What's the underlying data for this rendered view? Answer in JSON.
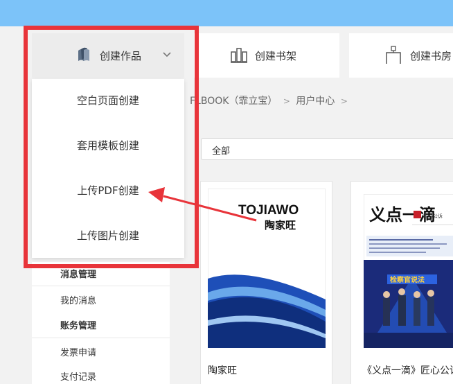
{
  "toolbar": {
    "create_label": "创建作品",
    "shelf_label": "创建书架",
    "room_label": "创建书房"
  },
  "dropdown": {
    "items": [
      "空白页面创建",
      "套用模板创建",
      "上传PDF创建",
      "上传图片创建"
    ]
  },
  "breadcrumb": {
    "part1": "FLBOOK（霏立宝）",
    "sep": ">",
    "part2": "用户中心",
    "sep2": ">"
  },
  "filter": {
    "value": "全部"
  },
  "sidebar": {
    "section_messages": "消息管理",
    "my_messages": "我的消息",
    "section_accounts": "账务管理",
    "invoice": "发票申请",
    "payments": "支付记录"
  },
  "cards": [
    {
      "title": "陶家旺",
      "brand": "TOJIAWO",
      "brand_cn": "陶家旺"
    },
    {
      "title": "《义点一滴》匠心公诉",
      "cover_title": "义点一滴",
      "cover_badge": "匠心公诉",
      "banner": "检察官说法"
    }
  ],
  "colors": {
    "topbar": "#7cc3f9",
    "highlight_border": "#e8343a",
    "arrow": "#e8343a"
  }
}
